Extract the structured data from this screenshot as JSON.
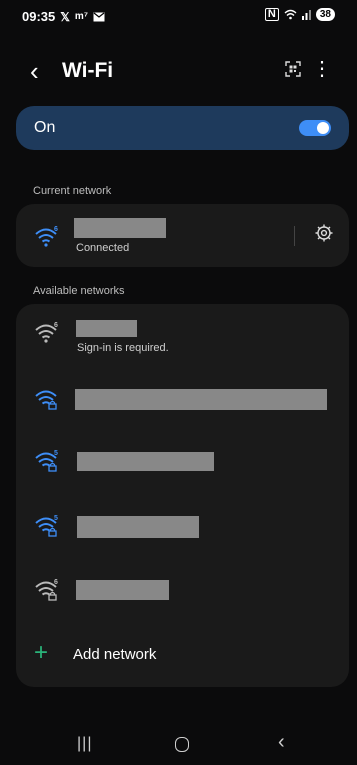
{
  "status_bar": {
    "time": "09:35",
    "left_icons": [
      "x-icon",
      "signal-arrow-icon",
      "mail-icon"
    ],
    "right_icons": [
      "nfc-icon",
      "wifi-status-icon",
      "signal-bars-icon"
    ],
    "battery": "38"
  },
  "header": {
    "title": "Wi-Fi"
  },
  "wifi_toggle": {
    "label": "On",
    "state": true
  },
  "current_network": {
    "section_label": "Current network",
    "status": "Connected",
    "wifi_version": "6"
  },
  "available_networks": {
    "section_label": "Available networks",
    "networks": [
      {
        "status": "Sign-in is required.",
        "wifi_version": "6",
        "secured": false
      },
      {
        "status": "",
        "wifi_version": "",
        "secured": true
      },
      {
        "status": "",
        "wifi_version": "5",
        "secured": true
      },
      {
        "status": "",
        "wifi_version": "5",
        "secured": true
      },
      {
        "status": "",
        "wifi_version": "6",
        "secured": true
      }
    ],
    "add_network_label": "Add network"
  },
  "colors": {
    "accent": "#3e8ef7",
    "toggle_card": "#1e3a5c",
    "plus": "#2ab47a",
    "background": "#0b0b0c",
    "card": "#1a1a1a"
  }
}
